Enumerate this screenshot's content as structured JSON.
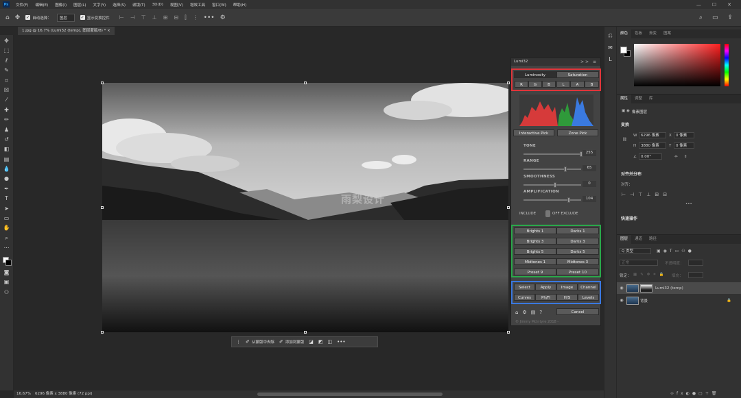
{
  "menubar": {
    "logo": "Ps",
    "items": [
      "文件(F)",
      "编辑(E)",
      "图像(I)",
      "图层(L)",
      "文字(Y)",
      "选择(S)",
      "滤镜(T)",
      "3D(D)",
      "视图(V)",
      "增效工具",
      "窗口(W)",
      "帮助(H)"
    ],
    "controls": [
      "—",
      "☐",
      "✕"
    ]
  },
  "options": {
    "auto_select_label": "自动选择：",
    "auto_select_value": "图层",
    "show_transform_label": "显示变换控件",
    "more": "•••"
  },
  "document": {
    "tab_title": "1.jpg @ 16.7% (Lumi32 (temp), 图层蒙版/8) *",
    "watermark": "雨梨设计"
  },
  "taskbar": {
    "remove_label": "从蒙版中去除",
    "add_label": "添加到蒙版",
    "more": "•••"
  },
  "status": {
    "zoom": "16.67%",
    "size": "6296 像素 x 3880 像素 (72 ppi)"
  },
  "lumi": {
    "title": "Lumi32",
    "controls": ">>  ≡",
    "tabs": [
      "Luminosity",
      "Saturation"
    ],
    "channels": [
      "R",
      "G",
      "B",
      "L",
      "A",
      "B"
    ],
    "picks": [
      "Interactive Pick",
      "Zone Pick"
    ],
    "sliders": [
      {
        "label": "TONE",
        "value": "255",
        "level": 1.0
      },
      {
        "label": "RANGE",
        "value": "65",
        "level": 0.73
      },
      {
        "label": "SMOOTHNESS",
        "value": "0",
        "level": 0.55
      },
      {
        "label": "AMPLIFICATION",
        "value": "104",
        "level": 0.78
      }
    ],
    "include_label": "INCLUDE",
    "exclude_label": "OFF EXCLUDE",
    "presets": [
      [
        "Brights 1",
        "Darks 1"
      ],
      [
        "Brights 3",
        "Darks 3"
      ],
      [
        "Brights 5",
        "Darks 5"
      ],
      [
        "Midtones 1",
        "Midtones 3"
      ],
      [
        "Preset 9",
        "Preset 10"
      ]
    ],
    "actions": [
      [
        "Select",
        "Apply",
        "Image",
        "Channel"
      ],
      [
        "Curves",
        "Ph/Fi",
        "H/S",
        "Levels"
      ]
    ],
    "cancel_label": "Cancel",
    "copyright": "© Jimmy McIntyre 2018 -",
    "colors": {
      "group_red": "#e0353a",
      "group_green": "#2aa84a",
      "group_blue": "#3a78e0"
    }
  },
  "color_panel": {
    "tabs": [
      "颜色",
      "色板",
      "渐变",
      "图案"
    ]
  },
  "properties": {
    "tabs": [
      "属性",
      "调整",
      "库"
    ],
    "layer_type": "像素图层",
    "transform_title": "变换",
    "w_label": "W",
    "w_value": "6296 像素",
    "x_label": "X",
    "x_value": "0 像素",
    "h_label": "H",
    "h_value": "3880 像素",
    "y_label": "Y",
    "y_value": "0 像素",
    "angle_value": "0.00°",
    "align_title": "对齐并分布",
    "align_sub": "对齐：",
    "more": "•••",
    "quick_title": "快速操作"
  },
  "layers": {
    "tabs": [
      "图层",
      "通道",
      "路径"
    ],
    "filter_label": "Q 类型",
    "blend_mode": "正常",
    "opacity_label": "不透明度：",
    "lock_label": "锁定：",
    "fill_label": "填充：",
    "items": [
      {
        "name": "Lumi32 (temp)",
        "selected": true
      },
      {
        "name": "背景",
        "selected": false
      }
    ],
    "bottom_icons": [
      "∞",
      "fx",
      "◐",
      "●",
      "▢",
      "+",
      "🗑"
    ]
  }
}
